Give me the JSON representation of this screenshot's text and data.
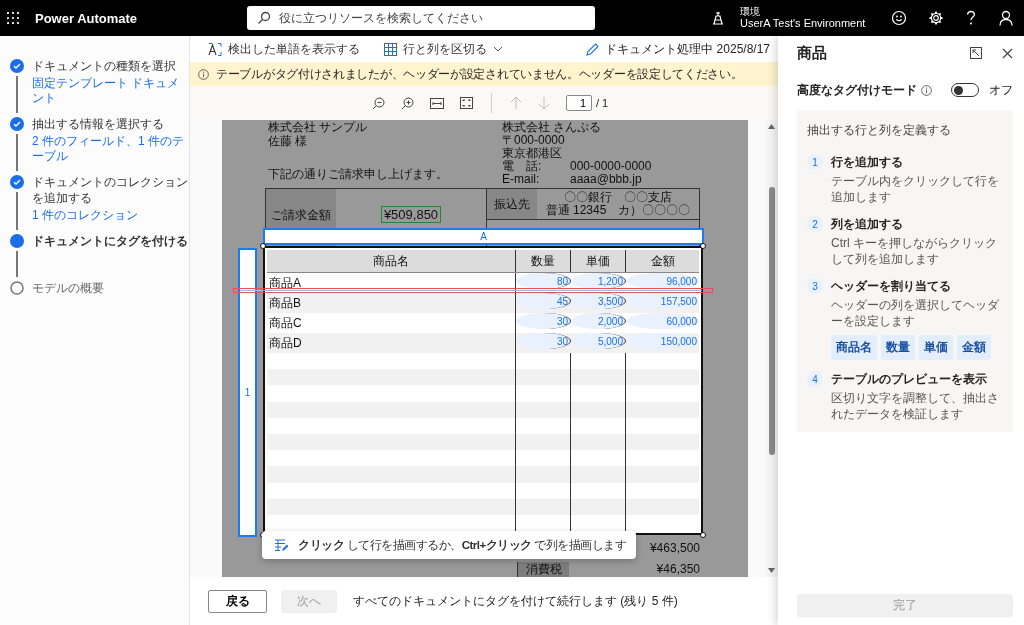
{
  "app": {
    "name": "Power Automate"
  },
  "search": {
    "placeholder": "役に立つリソースを検索してください"
  },
  "environment": {
    "label": "環境",
    "name": "UserA Test's Environment"
  },
  "steps": [
    {
      "title": "ドキュメントの種類を選択",
      "subtitle": "固定テンプレート ドキュメント",
      "completed": true,
      "selected": false
    },
    {
      "title": "抽出する情報を選択する",
      "subtitle": "2 件のフィールド、1 件のテーブル",
      "completed": true,
      "selected": false
    },
    {
      "title": "ドキュメントのコレクションを追加する",
      "subtitle": "1 件のコレクション",
      "completed": true,
      "selected": false
    },
    {
      "title": "ドキュメントにタグを付ける",
      "completed": false,
      "selected": true
    },
    {
      "title": "モデルの概要",
      "completed": false,
      "selected": false
    }
  ],
  "toolbar": {
    "show_words": "検出した単語を表示する",
    "split": "行と列を区切る",
    "document": "ドキュメント処理中 2025/8/17"
  },
  "warning": "テーブルがタグ付けされましたが、ヘッダーが設定されていません。ヘッダーを設定してください。",
  "viewer": {
    "page": "1",
    "total": "/ 1"
  },
  "document": {
    "company": "株式会社 サンプル",
    "recipient": "佐藤 様",
    "message": "下記の通りご請求申し上げます。",
    "sender_company": "株式会社 さんぷる",
    "postal": "〒000-0000",
    "address": "東京都港区",
    "phone_label": "電　話:",
    "phone": "000-0000-0000",
    "email_label": "E-mail:",
    "email": "aaaa@bbb.jp",
    "amount_label": "ご請求金額",
    "amount": "¥509,850",
    "bank_label": "振込先",
    "bank_lines": [
      "〇〇銀行　〇〇支店",
      "普通 12345　カ）〇〇〇〇"
    ],
    "subtotal": "¥463,500",
    "tax_label": "消費税",
    "tax": "¥46,350"
  },
  "table": {
    "column_tag": "A",
    "row_tag": "1",
    "columns": [
      "商品名",
      "数量",
      "単価",
      "金額"
    ],
    "rows": [
      [
        "商品A",
        "80",
        "1,200",
        "96,000"
      ],
      [
        "商品B",
        "45",
        "3,500",
        "157,500"
      ],
      [
        "商品C",
        "30",
        "2,000",
        "60,000"
      ],
      [
        "商品D",
        "30",
        "5,000",
        "150,000"
      ]
    ]
  },
  "hint": "**クリック** して行を描画するか、**Ctrl+クリック** で列を描画します",
  "footer": {
    "back": "戻る",
    "next": "次へ",
    "next_disabled": true,
    "message": "すべてのドキュメントにタグを付けて続行します (残り 5 件)"
  },
  "panel": {
    "title": "商品",
    "advanced_label": "高度なタグ付けモード",
    "advanced_on": false,
    "advanced_state": "オフ",
    "card_title": "抽出する行と列を定義する",
    "steps": [
      {
        "number": "1",
        "title": "行を追加する",
        "description": "テーブル内をクリックして行を追加します"
      },
      {
        "number": "2",
        "title": "列を追加する",
        "description": "Ctrl キーを押しながらクリックして列を追加します"
      },
      {
        "number": "3",
        "title": "ヘッダーを割り当てる",
        "description": "ヘッダーの列を選択してヘッダーを設定します",
        "tags": [
          "商品名",
          "数量",
          "単価",
          "金額"
        ]
      },
      {
        "number": "4",
        "title": "テーブルのプレビューを表示",
        "description": "区切り文字を調整して、抽出されたデータを検証します"
      }
    ],
    "done": "完了",
    "done_disabled": true
  }
}
